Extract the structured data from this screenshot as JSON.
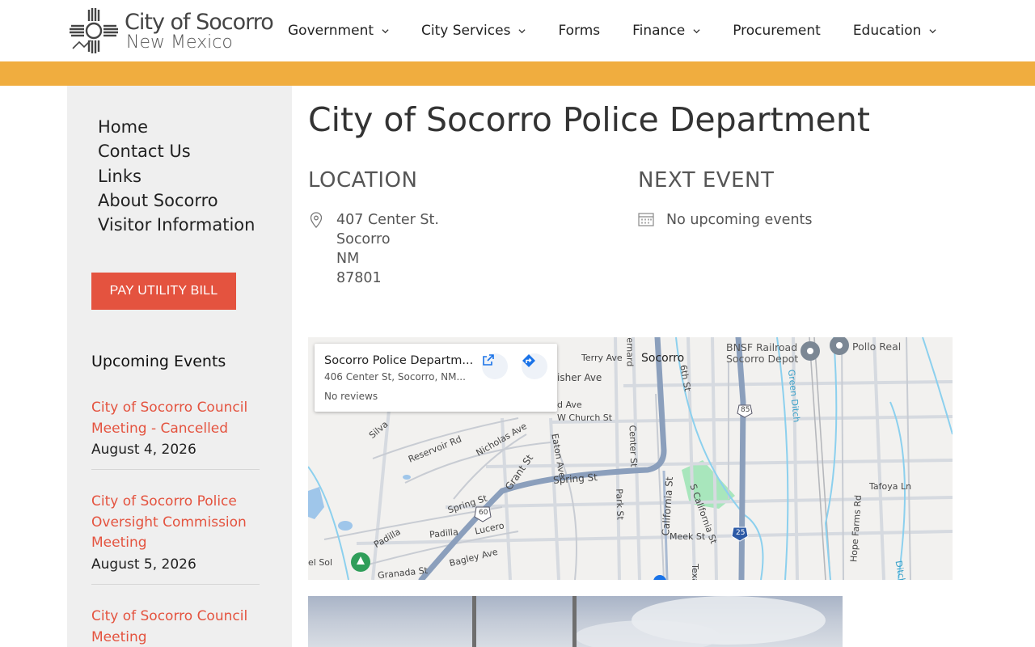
{
  "header": {
    "logo_title": "City of Socorro",
    "logo_subtitle": "New Mexico",
    "nav": [
      {
        "label": "Government",
        "has_dropdown": true
      },
      {
        "label": "City Services",
        "has_dropdown": true
      },
      {
        "label": "Forms",
        "has_dropdown": false
      },
      {
        "label": "Finance",
        "has_dropdown": true
      },
      {
        "label": "Procurement",
        "has_dropdown": false
      },
      {
        "label": "Education",
        "has_dropdown": true
      }
    ]
  },
  "sidebar": {
    "menu": [
      "Home",
      "Contact Us",
      "Links",
      "About Socorro",
      "Visitor Information"
    ],
    "pay_button": "PAY UTILITY BILL",
    "events_title": "Upcoming Events",
    "events": [
      {
        "title": "City of Socorro Council Meeting - Cancelled",
        "date": "August 4, 2026"
      },
      {
        "title": "City of Socorro Police Oversight Commission Meeting",
        "date": "August 5, 2026"
      },
      {
        "title": "City of Socorro Council Meeting",
        "date": ""
      }
    ]
  },
  "main": {
    "title": "City of Socorro Police Department",
    "location_heading": "LOCATION",
    "address": [
      "407 Center St.",
      "Socorro",
      "NM",
      "87801"
    ],
    "next_event_heading": "NEXT EVENT",
    "next_event_text": "No upcoming events"
  },
  "map": {
    "card_title": "Socorro Police Departm...",
    "card_address": "406 Center St, Socorro, NM...",
    "card_reviews": "No reviews",
    "labels": {
      "socorro": "Socorro",
      "bnsf": "BNSF Railroad",
      "depot": "Socorro Depot",
      "pollo": "Pollo Real",
      "spring1": "Spring St",
      "spring2": "Spring St",
      "grant": "Grant St",
      "nicholas": "Nicholas Ave",
      "reservoir": "Reservoir Rd",
      "church": "W Church St",
      "fisher": "isher Ave",
      "terry": "Terry Ave",
      "eaton": "Eaton Ave",
      "center": "Center St",
      "park": "Park St",
      "california": "California St",
      "scalifornia": "S California St",
      "meek": "Meek St",
      "padilla1": "Padilla",
      "padilla2": "Padilla",
      "lucero": "Lucero",
      "bagley": "Bagley Ave",
      "granada": "Granada St",
      "tafoya": "Tafoya Ln",
      "hope": "Hope Farms Rd",
      "green": "Green Ditch",
      "sixth": "6th St",
      "silva": "Silva",
      "bernard": "Bernard",
      "elsol": "el Sol",
      "ave": "d Ave",
      "texa": "Texa",
      "ditch": "Ditch",
      "rt60": "60",
      "rt85": "85",
      "rt25": "25"
    }
  },
  "colors": {
    "accent_band": "#f0ad3f",
    "button": "#e4533f",
    "event_link": "#e4533f",
    "sidebar_bg": "#efefef"
  }
}
